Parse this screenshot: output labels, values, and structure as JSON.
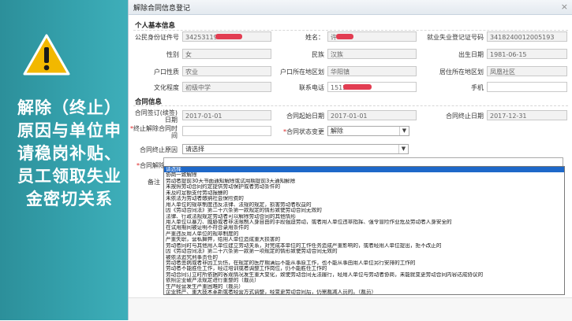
{
  "slide": {
    "lines": [
      "解除（终止）",
      "原因与单位申",
      "请稳岗补贴、",
      "员工领取失业",
      "金密切关系"
    ]
  },
  "dialog": {
    "title": "解除合同信息登记",
    "close": "×",
    "personal_section": "个人基本信息",
    "contract_section": "合同信息",
    "fields": {
      "id_label": "公民身份证件号",
      "id_value": "34253119",
      "name_label": "姓名：",
      "name_value": "许",
      "unemp_no_label": "就业失业登记证号码",
      "unemp_no_value": "3418240012005193",
      "gender_label": "性别",
      "gender_value": "女",
      "ethnic_label": "民族",
      "ethnic_value": "汉族",
      "birth_label": "出生日期",
      "birth_value": "1981-06-15",
      "hukou_type_label": "户口性质",
      "hukou_type_value": "农业",
      "hukou_area_label": "户口所在地区划",
      "hukou_area_value": "华阳镇",
      "live_area_label": "居住所在地区划",
      "live_area_value": "凤凰社区",
      "edu_label": "文化程度",
      "edu_value": "初级中学",
      "phone_label": "联系电话",
      "phone_value": "1515",
      "mobile_label": "手机",
      "mobile_value": "",
      "sign_date_label": "合同签订(续签)日期",
      "sign_date_value": "2017-01-01",
      "start_date_label": "合同起始日期",
      "start_date_value": "2017-01-01",
      "end_date_label": "合同终止日期",
      "end_date_value": "2017-12-31",
      "term_date_label": "终止解除合同时间",
      "term_date_value": "",
      "status_label": "合同状态变更",
      "status_value": "解除",
      "end_reason_label": "合同终止原因",
      "end_reason_value": "请选择",
      "release_reason_label": "合同解除原因",
      "release_reason_value": "",
      "remark_label": "备注"
    },
    "dropdown_items": [
      "请选择",
      "协商一致解除",
      "劳动者提前30天书面通知解除或试用期提前3天通知解除",
      "未按照劳动合同约定提供劳动保护或者劳动条件的",
      "未及时足额支付劳动报酬的",
      "未依法为劳动者缴纳社会保险费的",
      "用人单位的规章制度违反法律、法规的规定，损害劳动者权益的",
      "因《劳动合同法》第二十六条第一款规定的情形致使劳动合同无效的",
      "法律、行政法规规定劳动者可以解除劳动合同的其他情形",
      "用人单位以暴力、威胁或者非法限制人身自由的手段强迫劳动，或者用人单位违章指挥、强令冒险作业危及劳动者人身安全的",
      "在试用期间被证明不符合录用条件的",
      "严重违反用人单位的规章制度的",
      "严重失职，营私舞弊，给用人单位造成重大损害的",
      "劳动者同时与其他用人单位建立劳动关系，对完成本单位的工作任务造成严重影响的，或者经用人单位提出，拒不改正的",
      "因《劳动合同法》第二十六条第一款第一项规定的情形致使劳动合同无效的",
      "被依法追究刑事责任的",
      "劳动者患病或者非因工负伤，在规定的医疗期满后不能从事原工作，也不能从事由用人单位另行安排的工作的",
      "劳动者不能胜任工作，经过培训或者调整工作岗位，仍不能胜任工作的",
      "劳动合同订立时所依据的客观情况发生重大变化，致使劳动合同无法履行，经用人单位与劳动者协商，未能就变更劳动合同内容达成协议的",
      "依照企业破产法规定进行重整的（裁员）",
      "生产经营发生严重困难的（裁员）",
      "企业转产、重大技术革新或者经营方式调整，经变更劳动合同后，仍需裁减人员的。（裁员）",
      "其他因劳动合同订立时所依据的客观经济情况发生重大变化，致使劳动合同无法履行的（裁员）"
    ]
  }
}
